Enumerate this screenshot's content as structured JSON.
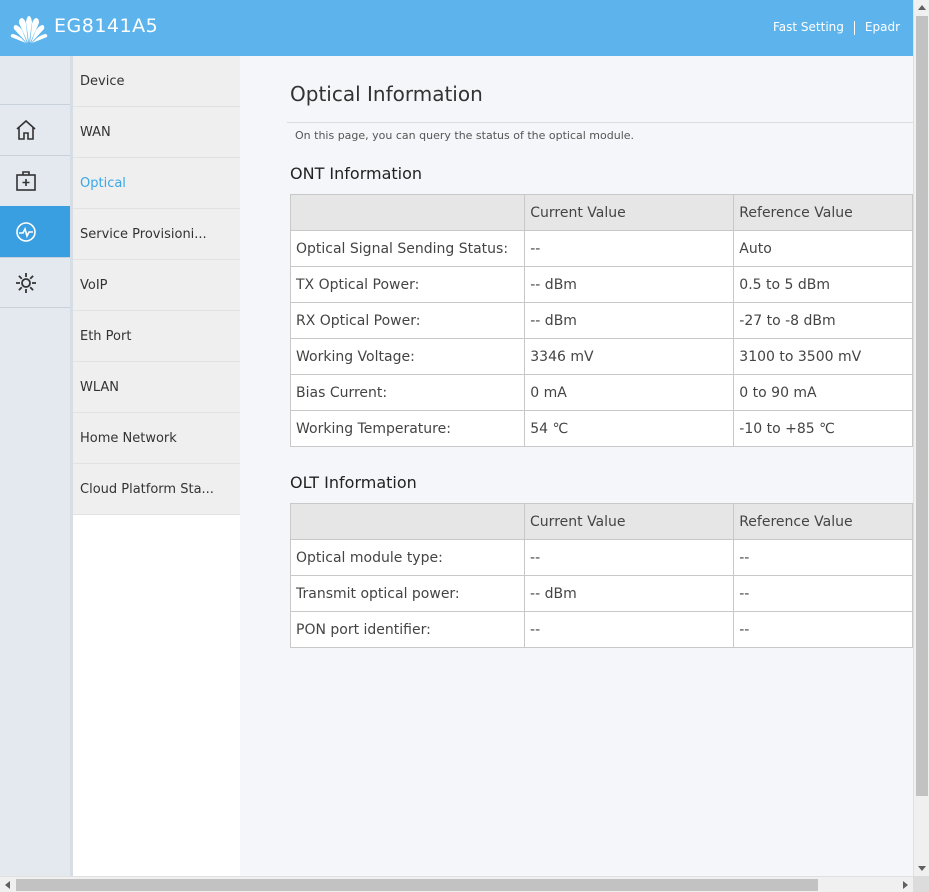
{
  "header": {
    "brand_color": "#5db4ec",
    "logo_icon": "huawei-logo",
    "product": "EG8141A5",
    "fast_setting": "Fast Setting",
    "truncated_link": "Epadr"
  },
  "rail": {
    "items": [
      {
        "icon": "home-icon"
      },
      {
        "icon": "first-aid-kit-icon"
      },
      {
        "icon": "status-monitor-icon",
        "active": true
      },
      {
        "icon": "gear-icon"
      }
    ],
    "active_color": "#3a9fe0"
  },
  "submenu": {
    "items": [
      {
        "label": "Device"
      },
      {
        "label": "WAN"
      },
      {
        "label": "Optical",
        "active": true
      },
      {
        "label": "Service Provisioni..."
      },
      {
        "label": "VoIP"
      },
      {
        "label": "Eth Port"
      },
      {
        "label": "WLAN"
      },
      {
        "label": "Home Network"
      },
      {
        "label": "Cloud Platform Sta..."
      }
    ],
    "active_color": "#39a7e6"
  },
  "main": {
    "title": "Optical Information",
    "description": "On this page, you can query the status of the optical module.",
    "ont": {
      "title": "ONT Information",
      "headers": [
        "",
        "Current Value",
        "Reference Value"
      ],
      "rows": [
        [
          "Optical Signal Sending Status:",
          "--",
          "Auto"
        ],
        [
          "TX Optical Power:",
          "-- dBm",
          "0.5 to 5 dBm"
        ],
        [
          "RX Optical Power:",
          "-- dBm",
          "-27 to -8 dBm"
        ],
        [
          "Working Voltage:",
          "3346 mV",
          "3100 to 3500 mV"
        ],
        [
          "Bias Current:",
          "0 mA",
          "0 to 90 mA"
        ],
        [
          "Working Temperature:",
          "54 ℃",
          "-10 to +85 ℃"
        ]
      ]
    },
    "olt": {
      "title": "OLT Information",
      "headers": [
        "",
        "Current Value",
        "Reference Value"
      ],
      "rows": [
        [
          "Optical module type:",
          "--",
          "--"
        ],
        [
          "Transmit optical power:",
          "-- dBm",
          "--"
        ],
        [
          "PON port identifier:",
          "--",
          "--"
        ]
      ]
    }
  }
}
